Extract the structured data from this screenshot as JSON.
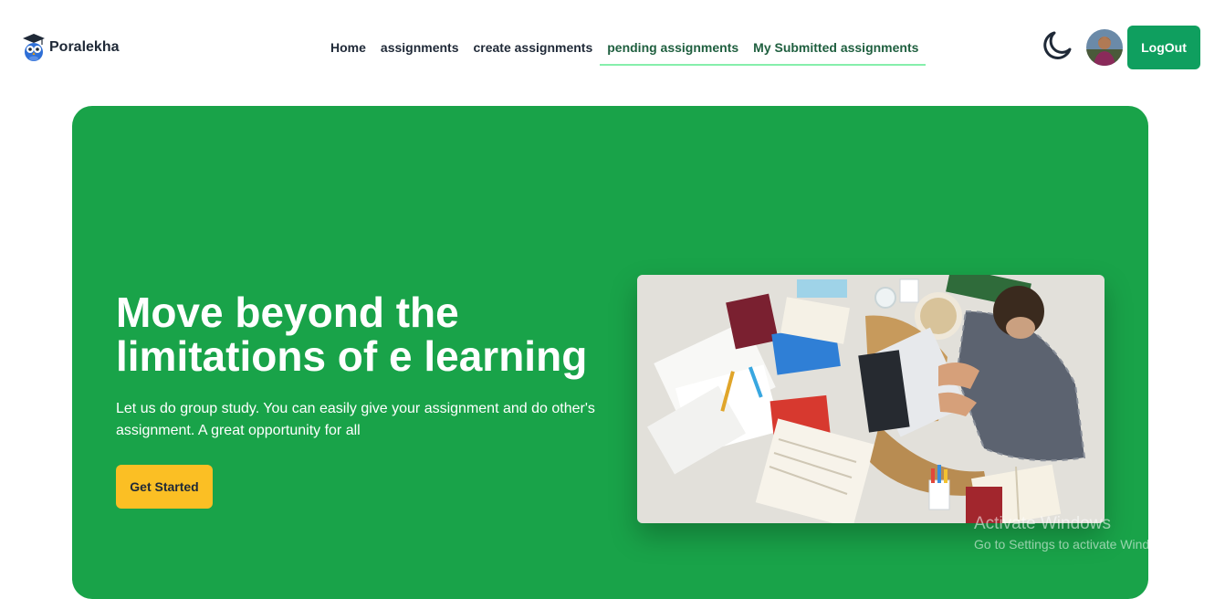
{
  "brand": {
    "name": "Poralekha",
    "logo_icon": "owl-graduate-icon"
  },
  "nav": {
    "links": [
      {
        "label": "Home",
        "active": false
      },
      {
        "label": "assignments",
        "active": false
      },
      {
        "label": "create assignments",
        "active": false
      },
      {
        "label": "pending assignments",
        "active": true
      },
      {
        "label": "My Submitted assignments",
        "active": true
      }
    ],
    "theme_icon": "moon-icon",
    "logout_label": "LogOut"
  },
  "hero": {
    "title": "Move beyond the limitations of e learning",
    "subtitle": "Let us do group study. You can easily give your assignment and do other's assignment. A great opportunity for all",
    "cta_label": "Get Started",
    "image": "student-with-laptop-and-books-photo"
  },
  "watermark": {
    "title": "Activate Windows",
    "subtitle": "Go to Settings to activate Windows."
  },
  "colors": {
    "hero_bg": "#19a349",
    "logout_bg": "#0f9f5f",
    "cta_bg": "#fbbf24",
    "active_link": "#1f5f3f",
    "active_underline": "#86efac"
  }
}
